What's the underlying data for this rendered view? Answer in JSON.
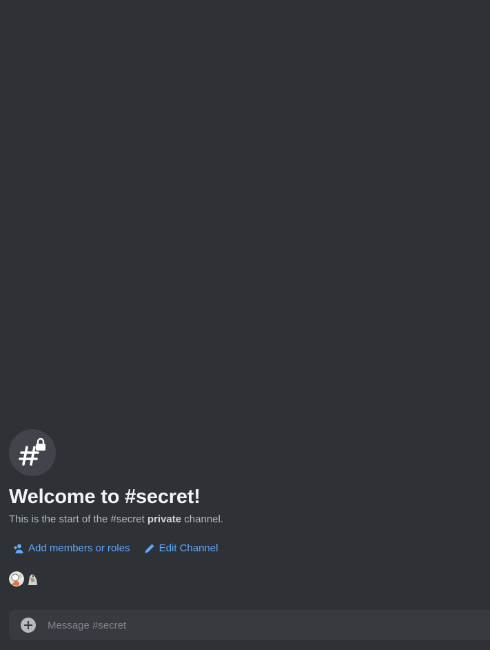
{
  "welcome": {
    "title": "Welcome to #secret!",
    "subtitle_prefix": "This is the start of the #secret ",
    "subtitle_bold": "private",
    "subtitle_suffix": " channel."
  },
  "actions": {
    "add_members_label": "Add members or roles",
    "edit_channel_label": "Edit Channel"
  },
  "composer": {
    "placeholder": "Message #secret"
  },
  "colors": {
    "background": "#2e3135",
    "link": "#5fa8ff",
    "title": "#f2f3f5",
    "composer": "#383a40"
  },
  "icons": {
    "channel": "hashtag-lock-icon",
    "add_members": "add-members-icon",
    "edit": "pencil-icon",
    "composer_add": "plus-circle-icon"
  }
}
